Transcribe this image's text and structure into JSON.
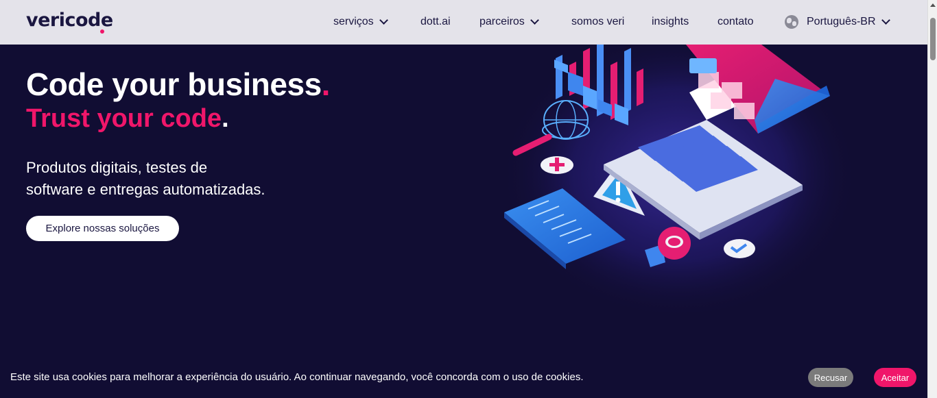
{
  "header": {
    "logo": "vericode",
    "nav": [
      {
        "label": "serviços",
        "dropdown": true
      },
      {
        "label": "dott.ai",
        "dropdown": false
      },
      {
        "label": "parceiros",
        "dropdown": true
      },
      {
        "label": "somos veri",
        "dropdown": false
      },
      {
        "label": "insights",
        "dropdown": false
      },
      {
        "label": "contato",
        "dropdown": false
      }
    ],
    "language": "Português-BR"
  },
  "hero": {
    "title": "Code your business",
    "title_dot": ".",
    "subtitle": "Trust your code",
    "subtitle_dot": ".",
    "description_line1": "Produtos digitais, testes de",
    "description_line2": "software e entregas automatizadas.",
    "cta": "Explore nossas soluções"
  },
  "cookie": {
    "text": "Este site usa cookies para melhorar a experiência do usuário. Ao continuar navegando, você concorda com o uso de cookies.",
    "refuse": "Recusar",
    "accept": "Aceitar"
  },
  "colors": {
    "brand_pink": "#f0166a",
    "background": "#110d33",
    "header_bg": "#e4e3ea"
  },
  "icons": [
    "chevron-down-icon",
    "globe-icon",
    "laptop-illustration"
  ]
}
